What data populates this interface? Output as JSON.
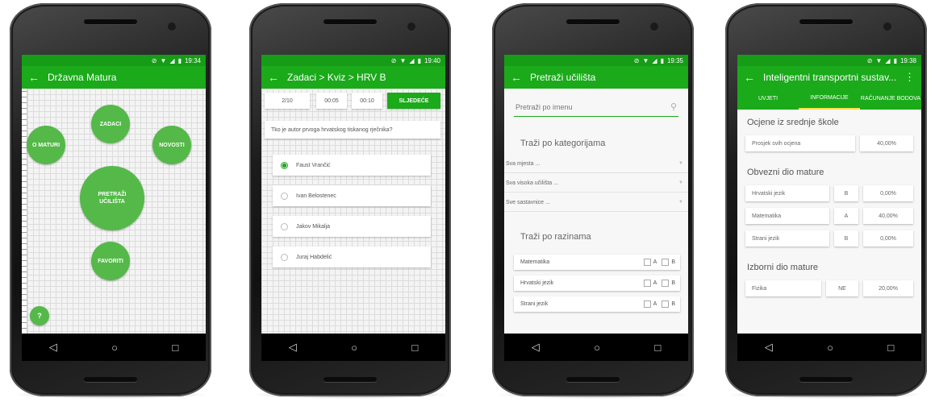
{
  "status": {
    "time1": "19:34",
    "time2": "19:40",
    "time3": "19:35",
    "time4": "19:38"
  },
  "nav_icons": {
    "back": "◁",
    "home": "○",
    "recent": "□"
  },
  "phone1": {
    "title": "Državna Matura",
    "buttons": {
      "o_maturi": "O MATURI",
      "zadaci": "ZADACI",
      "novosti": "NOVOSTI",
      "pretrazi": "PRETRAŽI UČILIŠTA",
      "favoriti": "FAVORITI",
      "help": "?"
    }
  },
  "phone2": {
    "title": "Zadaci > Kviz > HRV B",
    "counter": "2/10",
    "timer1": "00:05",
    "timer2": "00:10",
    "next": "SLJEDEĆE",
    "question": "Tko je autor prvoga hrvatskog tiskanog rječnika?",
    "answers": [
      "Faust Vrančić",
      "Ivan Belostenec",
      "Jakov Mikalja",
      "Juraj Habdelić"
    ]
  },
  "phone3": {
    "title": "Pretraži učilišta",
    "search_placeholder": "Pretraži po imenu",
    "cat_heading": "Traži po kategorijama",
    "dropdowns": [
      "Sva mjesta ...",
      "Sva visoka učilišta ...",
      "Sve sastavnice ..."
    ],
    "lvl_heading": "Traži po razinama",
    "levels": [
      "Matematika",
      "Hrvatski jezik",
      "Strani jezik"
    ],
    "opt_a": "A",
    "opt_b": "B"
  },
  "phone4": {
    "title": "Inteligentni transportni sustav...",
    "tabs": [
      "UVJETI",
      "INFORMACIJE",
      "RAČUNANJE BODOVA"
    ],
    "sec1": "Ocjene iz srednje škole",
    "sec1_row": {
      "label": "Prosjek svih ocjena",
      "pct": "40,00%"
    },
    "sec2": "Obvezni dio mature",
    "sec2_rows": [
      {
        "label": "Hrvatski jezik",
        "level": "B",
        "pct": "0,00%"
      },
      {
        "label": "Matematika",
        "level": "A",
        "pct": "40,00%"
      },
      {
        "label": "Strani jezik",
        "level": "B",
        "pct": "0,00%"
      }
    ],
    "sec3": "Izborni dio mature",
    "sec3_row": {
      "label": "Fizika",
      "level": "NE",
      "pct": "20,00%"
    }
  },
  "colors": {
    "primary": "#1aaa1a",
    "status_bar": "#169c16",
    "bubble": "#54b948",
    "accent_tab": "#ffe14a"
  }
}
